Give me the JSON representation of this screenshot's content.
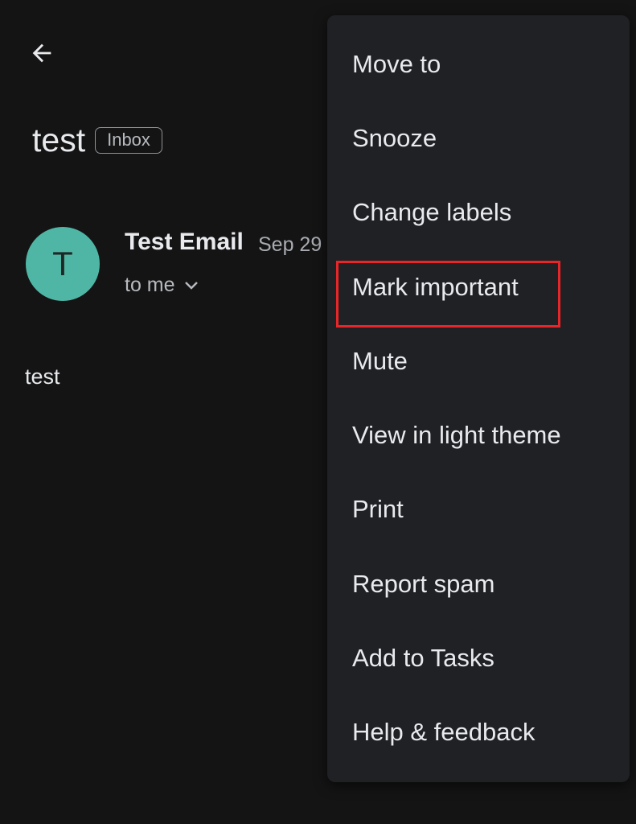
{
  "header": {
    "back_icon": "arrow-left-icon"
  },
  "email": {
    "subject": "test",
    "label": "Inbox",
    "sender": {
      "avatar_letter": "T",
      "avatar_color": "#4fb6a5",
      "name": "Test Email",
      "date": "Sep 29",
      "recipient": "to me",
      "expand_icon": "chevron-down-icon"
    },
    "body": "test"
  },
  "menu": {
    "items": [
      {
        "label": "Move to"
      },
      {
        "label": "Snooze"
      },
      {
        "label": "Change labels"
      },
      {
        "label": "Mark important"
      },
      {
        "label": "Mute"
      },
      {
        "label": "View in light theme"
      },
      {
        "label": "Print"
      },
      {
        "label": "Report spam"
      },
      {
        "label": "Add to Tasks"
      },
      {
        "label": "Help & feedback"
      }
    ],
    "highlighted_item": "Mark important",
    "highlight_color": "#e8262a",
    "background": "#202124"
  }
}
